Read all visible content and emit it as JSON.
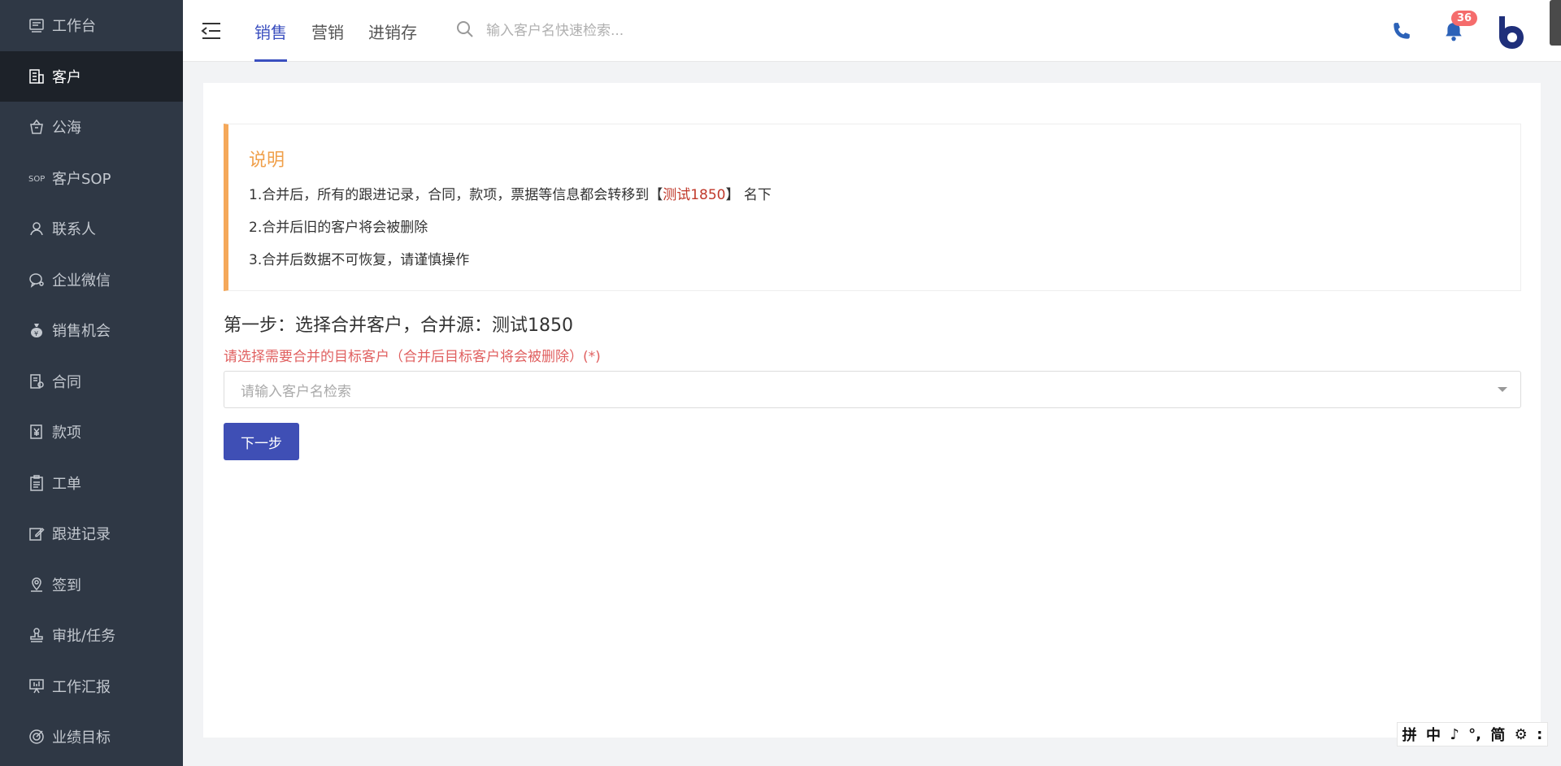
{
  "sidebar": {
    "items": [
      {
        "label": "工作台",
        "icon": "dashboard-icon"
      },
      {
        "label": "客户",
        "icon": "building-icon",
        "active": true
      },
      {
        "label": "公海",
        "icon": "basket-icon"
      },
      {
        "label": "客户SOP",
        "icon": "sop-icon"
      },
      {
        "label": "联系人",
        "icon": "person-icon"
      },
      {
        "label": "企业微信",
        "icon": "chat-icon"
      },
      {
        "label": "销售机会",
        "icon": "money-bag-icon"
      },
      {
        "label": "合同",
        "icon": "contract-icon"
      },
      {
        "label": "款项",
        "icon": "payment-icon"
      },
      {
        "label": "工单",
        "icon": "clipboard-icon"
      },
      {
        "label": "跟进记录",
        "icon": "edit-icon"
      },
      {
        "label": "签到",
        "icon": "location-icon"
      },
      {
        "label": "审批/任务",
        "icon": "stamp-icon"
      },
      {
        "label": "工作汇报",
        "icon": "presentation-icon"
      },
      {
        "label": "业绩目标",
        "icon": "target-icon"
      }
    ]
  },
  "header": {
    "tabs": [
      "销售",
      "营销",
      "进销存"
    ],
    "search_placeholder": "输入客户名快速检索...",
    "notification_count": "36"
  },
  "notice": {
    "title": "说明",
    "line1_prefix": "1.合并后，所有的跟进记录，合同，款项，票据等信息都会转移到【",
    "line1_highlight": "测试1850",
    "line1_suffix": "】 名下",
    "line2": "2.合并后旧的客户将会被删除",
    "line3": "3.合并后数据不可恢复，请谨慎操作"
  },
  "step": {
    "title": "第一步：选择合并客户，合并源：测试1850",
    "hint": "请选择需要合并的目标客户（合并后目标客户将会被删除）(*)",
    "select_placeholder": "请输入客户名检索",
    "next_label": "下一步"
  },
  "ime": [
    "拼",
    "中",
    "♪",
    "°,",
    "简",
    "⚙",
    ":"
  ],
  "colors": {
    "accent": "#3b4fbf",
    "sidebar_bg": "#2f3845",
    "notice_border": "#f5a85a",
    "hint_red": "#e06060"
  }
}
